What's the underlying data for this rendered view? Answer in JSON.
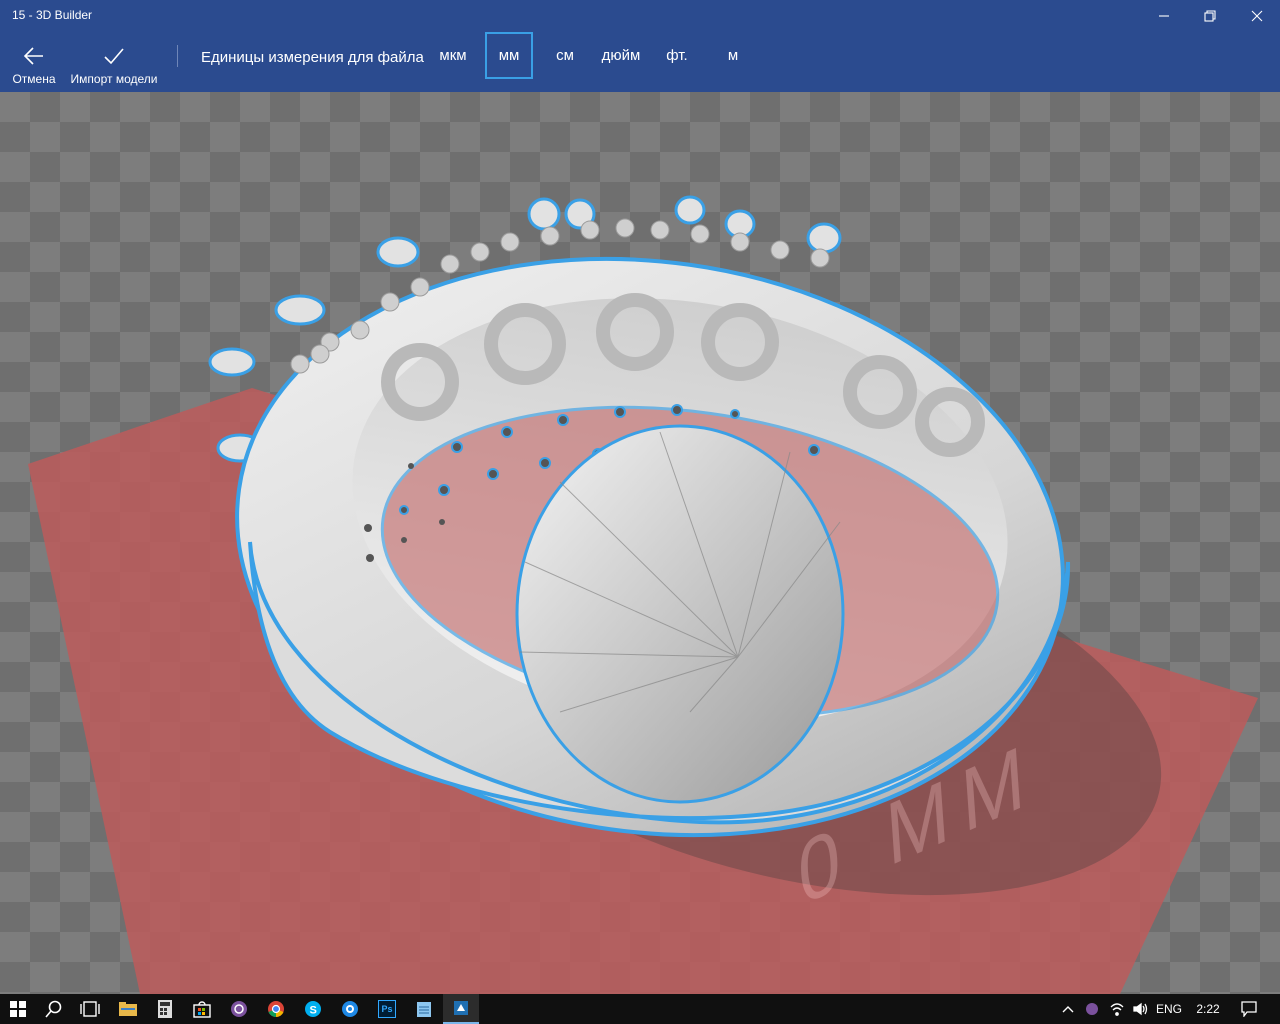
{
  "window": {
    "title": "15 - 3D Builder",
    "minimize_icon": "minimize-icon",
    "maximize_icon": "restore-icon",
    "close_icon": "close-icon"
  },
  "commandbar": {
    "cancel": {
      "label": "Отмена",
      "icon": "back-arrow-icon"
    },
    "import": {
      "label": "Импорт модели",
      "icon": "checkmark-icon"
    },
    "units_label": "Единицы измерения для файла",
    "units": [
      "мкм",
      "мм",
      "см",
      "дюйм",
      "фт.",
      "м"
    ],
    "selected_unit": "мм"
  },
  "viewport": {
    "build_plate_label": "0 MM",
    "model": "ring",
    "plate_color": "#c05a5a",
    "highlight_color": "#3aa0e6"
  },
  "taskbar": {
    "apps": [
      "start-icon",
      "search-icon",
      "task-view-icon",
      "file-explorer-icon",
      "calculator-icon",
      "store-icon",
      "viber-icon",
      "chrome-icon",
      "skype-icon",
      "camera-icon",
      "photoshop-icon",
      "notepad-icon",
      "3d-builder-icon"
    ],
    "photoshop_label": "Ps",
    "language": "ENG",
    "time": "2:22"
  },
  "colors": {
    "accent": "#2b4b8f",
    "selection": "#3aa0e6",
    "taskbar": "#101010"
  }
}
